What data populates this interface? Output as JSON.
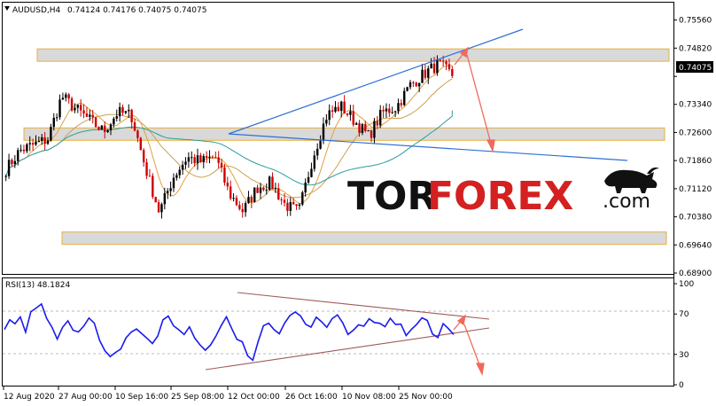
{
  "header": {
    "symbol": "AUDUSD,H4",
    "ohlc": "0.74124 0.74176 0.74075 0.74075"
  },
  "price_tag": {
    "value": "0.74075"
  },
  "watermark": {
    "brand_a": "TOR",
    "brand_b": "FOREX",
    "suffix": ".com"
  },
  "colors": {
    "bull": "#000000",
    "bear": "#cc0000",
    "ma_fast": "#e0a040",
    "ma_slow": "#2a9d9d",
    "ma_mid": "#caa050",
    "trend": "#2f6fd6",
    "zone_fill": "#d9d9d9",
    "zone_border": "#e8b040",
    "arrow": "#f06a5a",
    "rsi": "#1a1af0",
    "rsi_channel": "#a05a5a",
    "grid_dash": "#bbbbbb"
  },
  "chart_data": [
    {
      "type": "candlestick",
      "ylim": [
        0.689,
        0.759
      ],
      "yticks": [
        "0.75560",
        "0.74820",
        "0.74075",
        "0.73340",
        "0.72600",
        "0.71860",
        "0.71120",
        "0.70380",
        "0.69640",
        "0.68900"
      ],
      "xticks": [
        "12 Aug 2020",
        "27 Aug 00:00",
        "10 Sep 16:00",
        "25 Sep 08:00",
        "12 Oct 00:00",
        "26 Oct 16:00",
        "10 Nov 08:00",
        "25 Nov 00:00"
      ],
      "price_path": [
        [
          0.7155,
          0.717
        ],
        [
          0.72,
          0.7225
        ],
        [
          0.7265,
          0.719
        ],
        [
          0.7235,
          0.725
        ],
        [
          0.73,
          0.741
        ],
        [
          0.735,
          0.7295
        ],
        [
          0.728,
          0.7305
        ],
        [
          0.724,
          0.7285
        ],
        [
          0.732,
          0.7305
        ],
        [
          0.732,
          0.729
        ],
        [
          0.7195,
          0.714
        ],
        [
          0.706,
          0.704
        ],
        [
          0.7105,
          0.718
        ],
        [
          0.7215,
          0.7175
        ],
        [
          0.72,
          0.7165
        ],
        [
          0.7245,
          0.715
        ],
        [
          0.711,
          0.709
        ],
        [
          0.7045,
          0.706
        ],
        [
          0.71,
          0.713
        ],
        [
          0.7105,
          0.715
        ],
        [
          0.711,
          0.703
        ],
        [
          0.707,
          0.703
        ],
        [
          0.7125,
          0.7265
        ],
        [
          0.732,
          0.729
        ],
        [
          0.73,
          0.736
        ],
        [
          0.729,
          0.729
        ],
        [
          0.727,
          0.723
        ],
        [
          0.7295,
          0.733
        ],
        [
          0.7345,
          0.731
        ],
        [
          0.738,
          0.739
        ],
        [
          0.741,
          0.742
        ],
        [
          0.746,
          0.742
        ],
        [
          0.7415,
          0.7408
        ]
      ],
      "zones": [
        [
          0.7458,
          0.748
        ],
        [
          0.7253,
          0.7272
        ],
        [
          0.698,
          0.6998
        ]
      ],
      "annotation": "expected decline toward 0.7200"
    },
    {
      "type": "line",
      "title": "RSI(13) 48.1824",
      "ylim": [
        0,
        100
      ],
      "yticks": [
        "100",
        "70",
        "30",
        "0"
      ],
      "levels": [
        70,
        30
      ],
      "values": [
        56,
        62,
        58,
        66,
        52,
        70,
        74,
        78,
        64,
        54,
        44,
        58,
        62,
        55,
        50,
        60,
        64,
        60,
        42,
        34,
        26,
        30,
        38,
        48,
        54,
        58,
        50,
        44,
        40,
        46,
        62,
        66,
        60,
        54,
        50,
        58,
        46,
        38,
        34,
        40,
        48,
        60,
        66,
        54,
        46,
        44,
        28,
        24,
        40,
        58,
        62,
        54,
        50,
        60,
        68,
        74,
        70,
        62,
        58,
        66,
        60,
        56,
        66,
        70,
        62,
        52,
        56,
        62,
        58,
        66,
        64,
        60,
        58,
        66,
        62,
        58,
        50,
        56,
        62,
        68,
        64,
        52,
        46,
        60,
        54,
        48
      ],
      "channel": "converging (upper falling, lower rising)"
    }
  ]
}
